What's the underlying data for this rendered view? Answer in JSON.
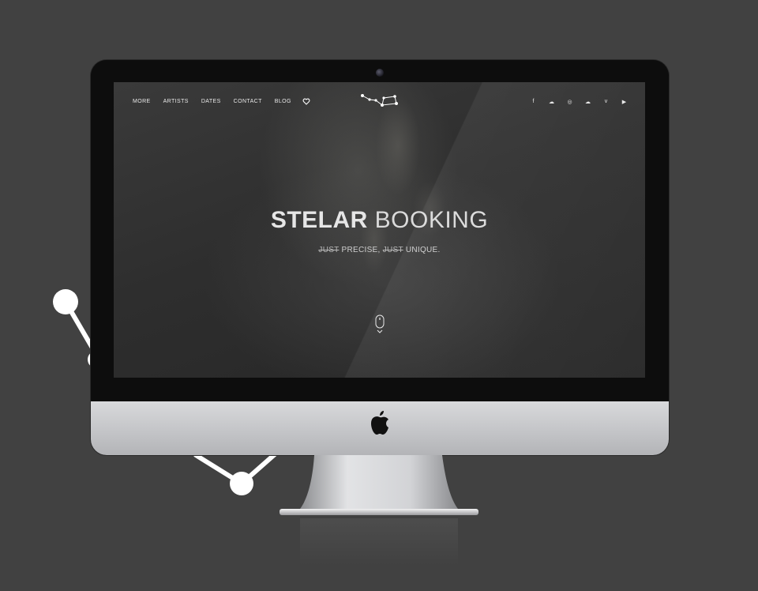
{
  "nav": {
    "items": [
      "MORE",
      "ARTISTS",
      "DATES",
      "CONTACT",
      "BLOG"
    ],
    "heart_icon": "heart-icon"
  },
  "site_logo": "constellation-logo",
  "social": {
    "icons": [
      "facebook-icon",
      "soundcloud-cloud-icon",
      "instagram-icon",
      "soundcloud-icon",
      "vimeo-icon",
      "youtube-icon"
    ],
    "glyphs": [
      "f",
      "☁",
      "◎",
      "☁",
      "v",
      "▶"
    ]
  },
  "hero": {
    "title_bold": "STELAR",
    "title_light": "BOOKING",
    "tagline_strike_1": "JUST",
    "tagline_part_1": "PRECISE,",
    "tagline_strike_2": "JUST",
    "tagline_part_2": "UNIQUE."
  },
  "colors": {
    "page_background": "#414141",
    "screen_background": "#2e2e2e",
    "text": "#e6e6e6",
    "monitor_chin": "#c4c5c8"
  }
}
